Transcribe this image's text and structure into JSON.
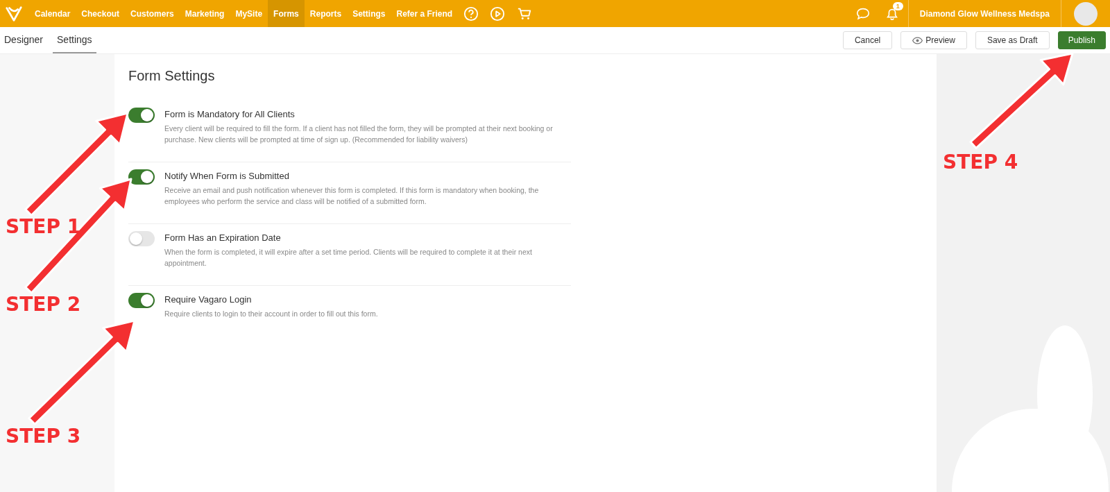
{
  "nav": {
    "items": [
      {
        "label": "Calendar",
        "selected": false
      },
      {
        "label": "Checkout",
        "selected": false
      },
      {
        "label": "Customers",
        "selected": false
      },
      {
        "label": "Marketing",
        "selected": false
      },
      {
        "label": "MySite",
        "selected": false
      },
      {
        "label": "Forms",
        "selected": true
      },
      {
        "label": "Reports",
        "selected": false
      },
      {
        "label": "Settings",
        "selected": false
      },
      {
        "label": "Refer a Friend",
        "selected": false
      }
    ],
    "notification_count": "1",
    "business_name": "Diamond Glow Wellness Medspa"
  },
  "subtabs": [
    {
      "label": "Designer",
      "selected": false
    },
    {
      "label": "Settings",
      "selected": true
    }
  ],
  "actions": [
    {
      "label": "Cancel",
      "kind": "plain"
    },
    {
      "label": "Preview",
      "kind": "preview"
    },
    {
      "label": "Save as Draft",
      "kind": "plain"
    },
    {
      "label": "Publish",
      "kind": "primary"
    }
  ],
  "form_settings": {
    "title": "Form Settings",
    "options": [
      {
        "title": "Form is Mandatory for All Clients",
        "description": "Every client will be required to fill the form. If a client has not filled the form, they will be prompted at their next booking or purchase. New clients will be prompted at time of sign up. (Recommended for liability waivers)",
        "on": true
      },
      {
        "title": "Notify When Form is Submitted",
        "description": "Receive an email and push notification whenever this form is completed. If this form is mandatory when booking, the employees who perform the service and class will be notified of a submitted form.",
        "on": true
      },
      {
        "title": "Form Has an Expiration Date",
        "description": "When the form is completed, it will expire after a set time period. Clients will be required to complete it at their next appointment.",
        "on": false
      },
      {
        "title": "Require Vagaro Login",
        "description": "Require clients to login to their account in order to fill out this form.",
        "on": true
      }
    ]
  },
  "annotations": [
    {
      "label": "STEP 1"
    },
    {
      "label": "STEP 2"
    },
    {
      "label": "STEP 3"
    },
    {
      "label": "STEP 4"
    }
  ]
}
